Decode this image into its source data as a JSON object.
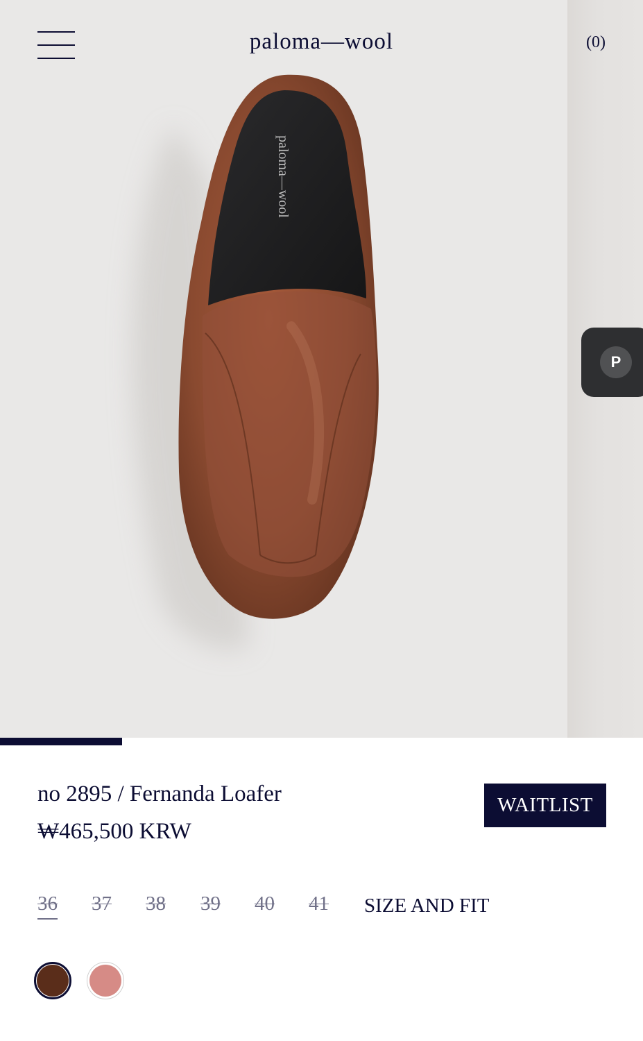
{
  "header": {
    "brand": "paloma—wool",
    "cart_label": "(0)"
  },
  "hero": {
    "insole_brand": "paloma—wool",
    "widget_letter": "P",
    "gallery_progress": 0.19
  },
  "product": {
    "title": "no 2895 / Fernanda Loafer",
    "price": "₩465,500 KRW",
    "waitlist_label": "WAITLIST"
  },
  "sizes": [
    {
      "label": "36",
      "available": false,
      "selected": true
    },
    {
      "label": "37",
      "available": false,
      "selected": false
    },
    {
      "label": "38",
      "available": false,
      "selected": false
    },
    {
      "label": "39",
      "available": false,
      "selected": false
    },
    {
      "label": "40",
      "available": false,
      "selected": false
    },
    {
      "label": "41",
      "available": false,
      "selected": false
    }
  ],
  "size_and_fit_label": "SIZE AND FIT",
  "colors": [
    {
      "name": "brown",
      "hex": "#5a2d1a",
      "selected": true
    },
    {
      "name": "pink",
      "hex": "#d68b86",
      "selected": false
    }
  ],
  "theme": {
    "navy": "#0c0d33",
    "leather": "#8a4a30"
  }
}
